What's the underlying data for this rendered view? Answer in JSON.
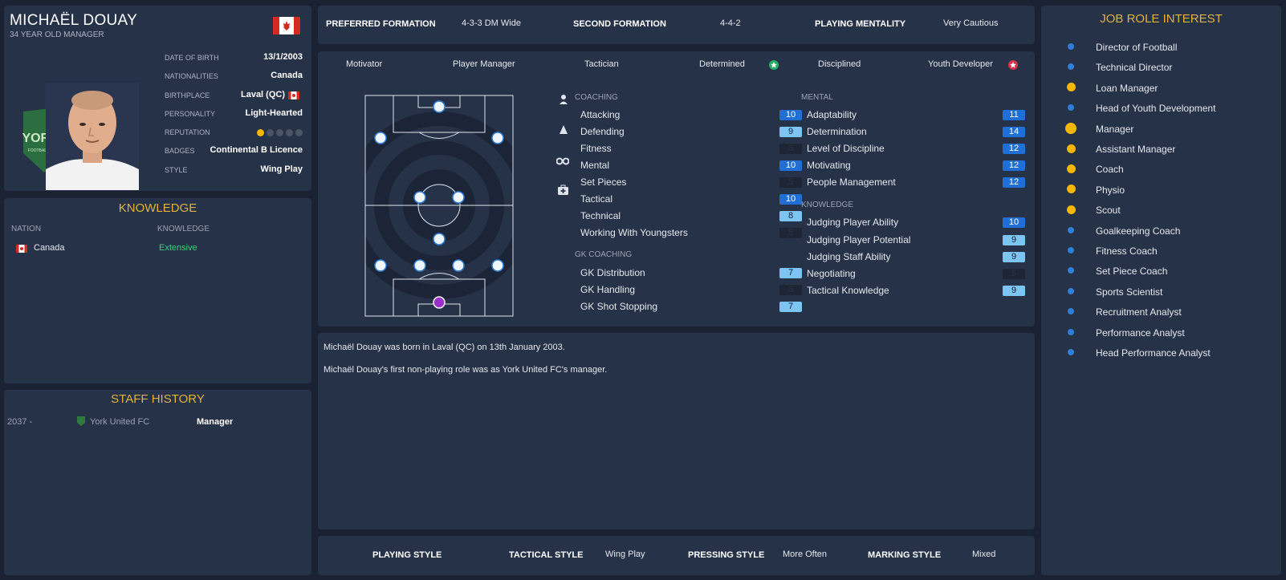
{
  "profile": {
    "name": "MICHAËL DOUAY",
    "subtitle": "34 YEAR OLD MANAGER",
    "details": [
      {
        "label": "Date of Birth",
        "value": "13/1/2003"
      },
      {
        "label": "Nationalities",
        "value": "Canada"
      },
      {
        "label": "Birthplace",
        "value": "Laval (QC)"
      },
      {
        "label": "Personality",
        "value": "Light-Hearted"
      },
      {
        "label": "Reputation",
        "value": ""
      },
      {
        "label": "Badges",
        "value": "Continental B Licence"
      },
      {
        "label": "Style",
        "value": "Wing Play"
      }
    ],
    "reputation_stars": 1,
    "reputation_max": 5,
    "crest_text": "YORK9",
    "crest_sub": "FOOTBALL CLUB"
  },
  "knowledge": {
    "title": "KNOWLEDGE",
    "col_nation": "NATION",
    "col_knowledge": "KNOWLEDGE",
    "nation": "Canada",
    "level": "Extensive"
  },
  "history": {
    "title": "STAFF HISTORY",
    "rows": [
      {
        "years": "2037 -",
        "club": "York United FC",
        "role": "Manager"
      }
    ]
  },
  "formations": {
    "preferred_label": "PREFERRED FORMATION",
    "preferred_value": "4-3-3 DM Wide",
    "second_label": "SECOND FORMATION",
    "second_value": "4-4-2",
    "mentality_label": "PLAYING MENTALITY",
    "mentality_value": "Very Cautious"
  },
  "traits": [
    "Motivator",
    "Player Manager",
    "Tactician",
    "Determined",
    "Disciplined",
    "Youth Developer"
  ],
  "coaching": {
    "head": "COACHING",
    "items": [
      {
        "name": "Attacking",
        "value": "10"
      },
      {
        "name": "Defending",
        "value": "9"
      },
      {
        "name": "Fitness",
        "value": "3"
      },
      {
        "name": "Mental",
        "value": "10"
      },
      {
        "name": "Set Pieces",
        "value": "5"
      },
      {
        "name": "Tactical",
        "value": "10"
      },
      {
        "name": "Technical",
        "value": "8"
      },
      {
        "name": "Working With Youngsters",
        "value": "5"
      }
    ]
  },
  "gk_coaching": {
    "head": "GK COACHING",
    "items": [
      {
        "name": "GK Distribution",
        "value": "7"
      },
      {
        "name": "GK Handling",
        "value": "3"
      },
      {
        "name": "GK Shot Stopping",
        "value": "7"
      }
    ]
  },
  "mental": {
    "head": "MENTAL",
    "items": [
      {
        "name": "Adaptability",
        "value": "11"
      },
      {
        "name": "Determination",
        "value": "14"
      },
      {
        "name": "Level of Discipline",
        "value": "12"
      },
      {
        "name": "Motivating",
        "value": "12"
      },
      {
        "name": "People Management",
        "value": "12"
      }
    ]
  },
  "knowledge_attrs": {
    "head": "KNOWLEDGE",
    "items": [
      {
        "name": "Judging Player Ability",
        "value": "10"
      },
      {
        "name": "Judging Player Potential",
        "value": "9"
      },
      {
        "name": "Judging Staff Ability",
        "value": "9"
      },
      {
        "name": "Negotiating",
        "value": "5"
      },
      {
        "name": "Tactical Knowledge",
        "value": "9"
      }
    ]
  },
  "bio": {
    "line1": "Michaël Douay was born in Laval (QC) on 13th January 2003.",
    "line2": "Michaël Douay's first non-playing role was as York United FC's manager."
  },
  "styles": {
    "playing_label": "PLAYING STYLE",
    "playing_value": "",
    "tactical_label": "TACTICAL STYLE",
    "tactical_value": "Wing Play",
    "pressing_label": "PRESSING STYLE",
    "pressing_value": "More Often",
    "marking_label": "MARKING STYLE",
    "marking_value": "Mixed"
  },
  "job_roles": {
    "title": "JOB ROLE INTEREST",
    "items": [
      {
        "label": "Director of Football",
        "level": "low"
      },
      {
        "label": "Technical Director",
        "level": "low"
      },
      {
        "label": "Loan Manager",
        "level": "mid"
      },
      {
        "label": "Head of Youth Development",
        "level": "low"
      },
      {
        "label": "Manager",
        "level": "high"
      },
      {
        "label": "Assistant Manager",
        "level": "mid"
      },
      {
        "label": "Coach",
        "level": "mid"
      },
      {
        "label": "Physio",
        "level": "mid"
      },
      {
        "label": "Scout",
        "level": "mid"
      },
      {
        "label": "Goalkeeping Coach",
        "level": "low"
      },
      {
        "label": "Fitness Coach",
        "level": "low"
      },
      {
        "label": "Set Piece Coach",
        "level": "low"
      },
      {
        "label": "Sports Scientist",
        "level": "low"
      },
      {
        "label": "Recruitment Analyst",
        "level": "low"
      },
      {
        "label": "Performance Analyst",
        "level": "low"
      },
      {
        "label": "Head Performance Analyst",
        "level": "low"
      }
    ]
  },
  "colors": {
    "gold": "#e3b23c",
    "blue_dot": "#2f7ed8",
    "yellow_dot": "#f5b700",
    "box_dark_blue": "#1f6fd6",
    "box_light_blue": "#7cc4f2",
    "box_dim": "#1e2636",
    "green": "#3ad07a"
  }
}
